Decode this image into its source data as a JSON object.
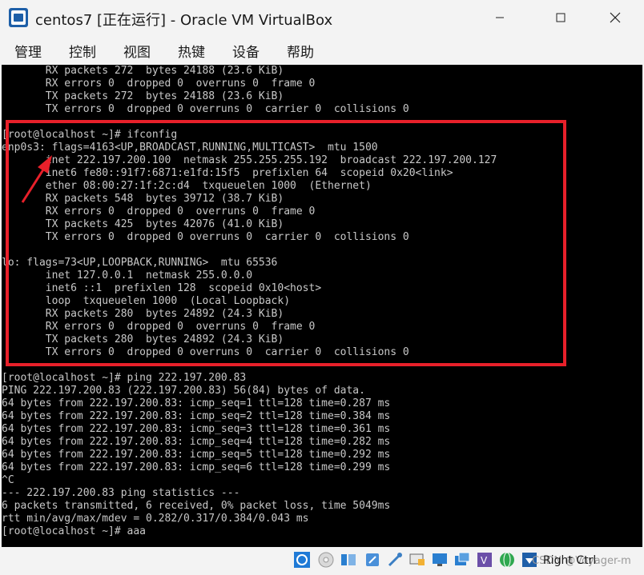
{
  "window": {
    "title": "centos7 [正在运行] - Oracle VM VirtualBox",
    "icon": "virtualbox-logo-icon"
  },
  "menu": [
    "管理",
    "控制",
    "视图",
    "热键",
    "设备",
    "帮助"
  ],
  "terminal": {
    "lines": [
      "       RX packets 272  bytes 24188 (23.6 KiB)",
      "       RX errors 0  dropped 0  overruns 0  frame 0",
      "       TX packets 272  bytes 24188 (23.6 KiB)",
      "       TX errors 0  dropped 0 overruns 0  carrier 0  collisions 0",
      "",
      "[root@localhost ~]# ifconfig",
      "enp0s3: flags=4163<UP,BROADCAST,RUNNING,MULTICAST>  mtu 1500",
      "       inet 222.197.200.100  netmask 255.255.255.192  broadcast 222.197.200.127",
      "       inet6 fe80::91f7:6871:e1fd:15f5  prefixlen 64  scopeid 0x20<link>",
      "       ether 08:00:27:1f:2c:d4  txqueuelen 1000  (Ethernet)",
      "       RX packets 548  bytes 39712 (38.7 KiB)",
      "       RX errors 0  dropped 0  overruns 0  frame 0",
      "       TX packets 425  bytes 42076 (41.0 KiB)",
      "       TX errors 0  dropped 0 overruns 0  carrier 0  collisions 0",
      "",
      "lo: flags=73<UP,LOOPBACK,RUNNING>  mtu 65536",
      "       inet 127.0.0.1  netmask 255.0.0.0",
      "       inet6 ::1  prefixlen 128  scopeid 0x10<host>",
      "       loop  txqueuelen 1000  (Local Loopback)",
      "       RX packets 280  bytes 24892 (24.3 KiB)",
      "       RX errors 0  dropped 0  overruns 0  frame 0",
      "       TX packets 280  bytes 24892 (24.3 KiB)",
      "       TX errors 0  dropped 0 overruns 0  carrier 0  collisions 0",
      "",
      "[root@localhost ~]# ping 222.197.200.83",
      "PING 222.197.200.83 (222.197.200.83) 56(84) bytes of data.",
      "64 bytes from 222.197.200.83: icmp_seq=1 ttl=128 time=0.287 ms",
      "64 bytes from 222.197.200.83: icmp_seq=2 ttl=128 time=0.384 ms",
      "64 bytes from 222.197.200.83: icmp_seq=3 ttl=128 time=0.361 ms",
      "64 bytes from 222.197.200.83: icmp_seq=4 ttl=128 time=0.282 ms",
      "64 bytes from 222.197.200.83: icmp_seq=5 ttl=128 time=0.292 ms",
      "64 bytes from 222.197.200.83: icmp_seq=6 ttl=128 time=0.299 ms",
      "^C",
      "--- 222.197.200.83 ping statistics ---",
      "6 packets transmitted, 6 received, 0% packet loss, time 5049ms",
      "rtt min/avg/max/mdev = 0.282/0.317/0.384/0.043 ms",
      "[root@localhost ~]# aaa"
    ]
  },
  "annotation": {
    "box_color": "#e8202a",
    "arrow_color": "#e8202a"
  },
  "statusbar": {
    "host_key": "Right Ctrl",
    "watermark": "CSDN @Voyager-m",
    "icons": [
      "cd-icon",
      "disk-icon",
      "network-icon",
      "usb-icon",
      "shared-folder-icon",
      "display-icon",
      "network-adapter-icon",
      "capture-icon",
      "mouse-integration-icon",
      "keyboard-capture-icon"
    ]
  }
}
